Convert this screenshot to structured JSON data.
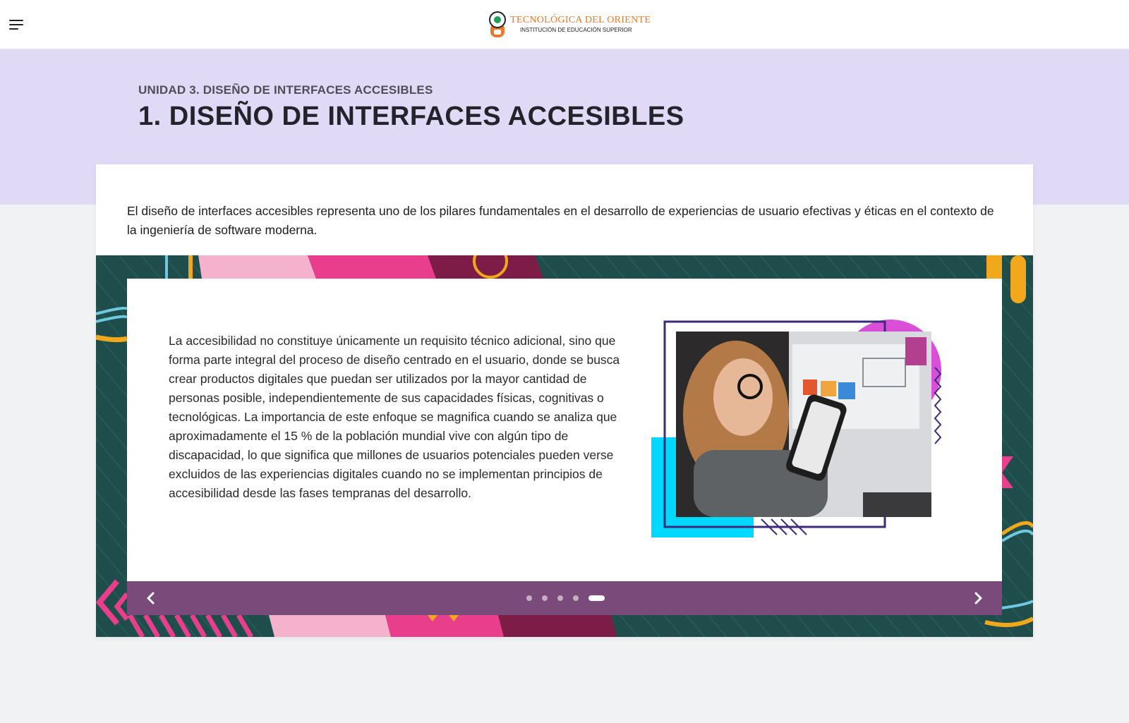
{
  "header": {
    "menu_icon": "hamburger-menu-icon",
    "logo_name": "TECNOLÓGICA DEL ORIENTE",
    "logo_subtitle": "INSTITUCIÓN DE EDUCACIÓN SUPERIOR"
  },
  "hero": {
    "kicker": "UNIDAD 3. DISEÑO DE INTERFACES ACCESIBLES",
    "title": "1. DISEÑO DE INTERFACES ACCESIBLES"
  },
  "intro": "El diseño de interfaces accesibles representa uno de los pilares fundamentales en el desarrollo de experiencias de usuario efectivas y éticas en el contexto de la ingeniería de software moderna.",
  "carousel": {
    "slide_text": "La accesibilidad no constituye únicamente un requisito técnico adicional, sino que forma parte integral del proceso de diseño centrado en el usuario, donde se busca crear productos digitales que puedan ser utilizados por la mayor cantidad de personas posible, independientemente de sus capacidades físicas, cognitivas o tecnológicas. La importancia de este enfoque se magnifica cuando se analiza que aproximadamente el 15 % de la población mundial vive con algún tipo de discapacidad, lo que significa que millones de usuarios potenciales pueden verse excluidos de las experiencias digitales cuando no se implementan principios de accesibilidad desde las fases tempranas del desarrollo.",
    "slide_count": 5,
    "active_slide": 5,
    "prev_icon": "chevron-left-icon",
    "next_icon": "chevron-right-icon"
  },
  "colors": {
    "hero_bg": "#e0daf6",
    "carousel_bg": "#1e4d4b",
    "nav_bar": "#7a4a7a",
    "logo_orange": "#e9782c",
    "accent_pink": "#e83e8c",
    "accent_magenta": "#d94fd8",
    "accent_cyan": "#00d9ff",
    "accent_yellow": "#f2a81d"
  }
}
